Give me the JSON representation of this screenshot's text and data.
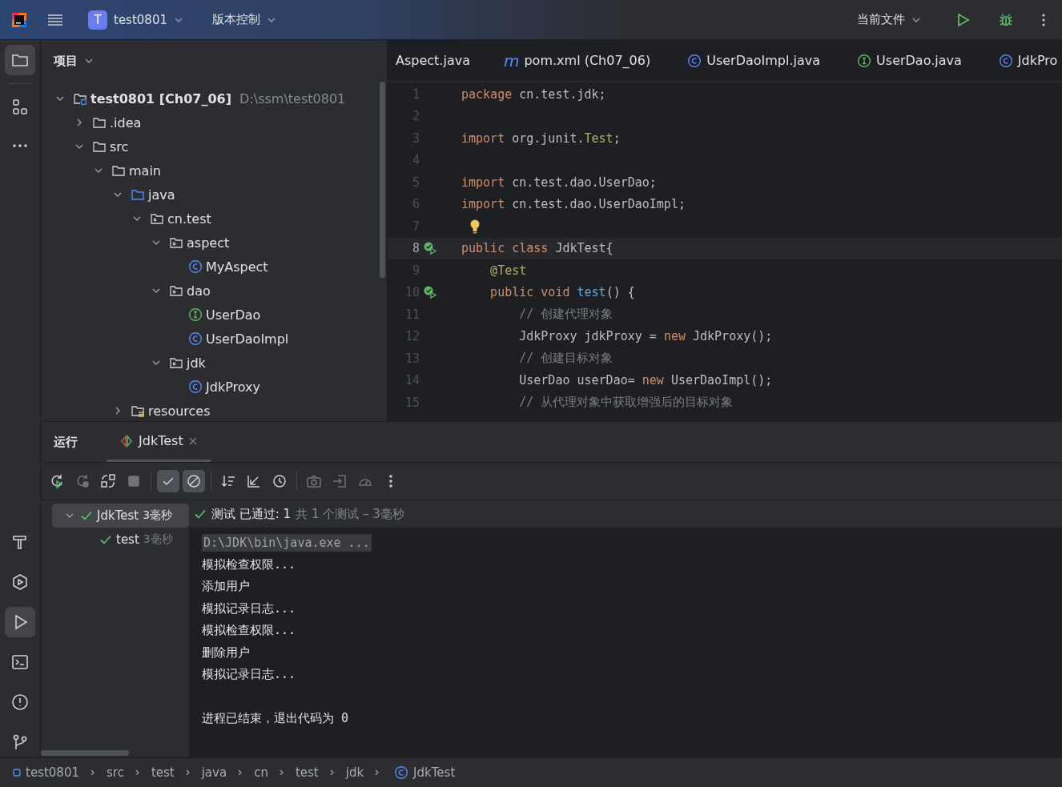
{
  "title_bar": {
    "project_badge": "T",
    "project": "test0801",
    "vcs": "版本控制",
    "run_config": "当前文件"
  },
  "left_rail": {
    "top": [
      {
        "kind": "folder",
        "selected": true
      },
      {
        "kind": "structure",
        "selected": false
      },
      {
        "kind": "more",
        "selected": false
      }
    ],
    "bottom": [
      {
        "kind": "build",
        "selected": false
      },
      {
        "kind": "services",
        "selected": false
      },
      {
        "kind": "run",
        "selected": true
      },
      {
        "kind": "terminal",
        "selected": false
      },
      {
        "kind": "problems",
        "selected": false
      },
      {
        "kind": "git",
        "selected": false
      }
    ]
  },
  "project_panel": {
    "title": "项目",
    "tree": [
      {
        "label": "test0801 [Ch07_06]",
        "detail": "D:\\ssm\\test0801",
        "kind": "module",
        "expanded": true,
        "children": [
          {
            "label": ".idea",
            "kind": "folder",
            "expanded": false
          },
          {
            "label": "src",
            "kind": "folder",
            "expanded": true,
            "children": [
              {
                "label": "main",
                "kind": "folder",
                "expanded": true,
                "children": [
                  {
                    "label": "java",
                    "kind": "source",
                    "expanded": true,
                    "children": [
                      {
                        "label": "cn.test",
                        "kind": "package",
                        "expanded": true,
                        "children": [
                          {
                            "label": "aspect",
                            "kind": "package",
                            "expanded": true,
                            "children": [
                              {
                                "label": "MyAspect",
                                "kind": "class"
                              }
                            ]
                          },
                          {
                            "label": "dao",
                            "kind": "package",
                            "expanded": true,
                            "children": [
                              {
                                "label": "UserDao",
                                "kind": "interface"
                              },
                              {
                                "label": "UserDaoImpl",
                                "kind": "class"
                              }
                            ]
                          },
                          {
                            "label": "jdk",
                            "kind": "package",
                            "expanded": true,
                            "children": [
                              {
                                "label": "JdkProxy",
                                "kind": "class"
                              }
                            ]
                          }
                        ]
                      }
                    ]
                  },
                  {
                    "label": "resources",
                    "kind": "resources",
                    "expanded": false
                  }
                ]
              }
            ]
          }
        ]
      }
    ]
  },
  "editor": {
    "tabs": [
      {
        "label": "Aspect.java",
        "kind": "none",
        "selected": false
      },
      {
        "label": "pom.xml (Ch07_06)",
        "kind": "maven",
        "icon_text": "m",
        "selected": false
      },
      {
        "label": "UserDaoImpl.java",
        "kind": "class",
        "selected": false
      },
      {
        "label": "UserDao.java",
        "kind": "interface",
        "selected": false
      },
      {
        "label": "JdkPro",
        "kind": "class",
        "selected": false
      }
    ],
    "lines": [
      {
        "number": "1",
        "tokens": [
          {
            "kind": "keyword",
            "text": "package "
          },
          {
            "kind": "plain",
            "text": "cn.test.jdk;"
          }
        ]
      },
      {
        "number": "2"
      },
      {
        "number": "3",
        "tokens": [
          {
            "kind": "keyword",
            "text": "import "
          },
          {
            "kind": "plain",
            "text": "org.junit."
          },
          {
            "kind": "annotation",
            "text": "Test"
          },
          {
            "kind": "plain",
            "text": ";"
          }
        ]
      },
      {
        "number": "4"
      },
      {
        "number": "5",
        "tokens": [
          {
            "kind": "keyword",
            "text": "import "
          },
          {
            "kind": "plain",
            "text": "cn.test.dao.UserDao;"
          }
        ]
      },
      {
        "number": "6",
        "tokens": [
          {
            "kind": "keyword",
            "text": "import "
          },
          {
            "kind": "plain",
            "text": "cn.test.dao.UserDaoImpl;"
          }
        ]
      },
      {
        "number": "7",
        "bulb": true
      },
      {
        "number": "8",
        "run_marker": true,
        "current": true,
        "tokens": [
          {
            "kind": "keyword",
            "text": "public class "
          },
          {
            "kind": "plain",
            "text": "JdkTest{"
          }
        ]
      },
      {
        "number": "9",
        "tokens": [
          {
            "kind": "annotation",
            "text": "    @Test"
          }
        ]
      },
      {
        "number": "10",
        "run_marker": true,
        "tokens": [
          {
            "kind": "keyword",
            "text": "    public void "
          },
          {
            "kind": "method",
            "text": "test"
          },
          {
            "kind": "plain",
            "text": "() {"
          }
        ]
      },
      {
        "number": "11",
        "tokens": [
          {
            "kind": "comment",
            "text": "        // 创建代理对象"
          }
        ]
      },
      {
        "number": "12",
        "tokens": [
          {
            "kind": "plain",
            "text": "        JdkProxy jdkProxy = "
          },
          {
            "kind": "keyword",
            "text": "new "
          },
          {
            "kind": "plain",
            "text": "JdkProxy();"
          }
        ]
      },
      {
        "number": "13",
        "tokens": [
          {
            "kind": "comment",
            "text": "        // 创建目标对象"
          }
        ]
      },
      {
        "number": "14",
        "tokens": [
          {
            "kind": "plain",
            "text": "        UserDao userDao= "
          },
          {
            "kind": "keyword",
            "text": "new "
          },
          {
            "kind": "plain",
            "text": "UserDaoImpl();"
          }
        ]
      },
      {
        "number": "15",
        "tokens": [
          {
            "kind": "comment",
            "text": "        // 从代理对象中获取增强后的目标对象"
          }
        ]
      }
    ]
  },
  "run_panel": {
    "title": "运行",
    "tab": "JdkTest",
    "toolbar": [
      {
        "kind": "rerun",
        "disabled": false,
        "selected": false
      },
      {
        "kind": "rerun-failed",
        "disabled": true,
        "selected": false
      },
      {
        "kind": "toggle",
        "disabled": false,
        "selected": false
      },
      {
        "kind": "stop",
        "disabled": true,
        "selected": false
      },
      {
        "kind": "sep"
      },
      {
        "kind": "passed",
        "disabled": false,
        "selected": true
      },
      {
        "kind": "ignored",
        "disabled": false,
        "selected": true
      },
      {
        "kind": "sep"
      },
      {
        "kind": "sort",
        "disabled": false,
        "selected": false
      },
      {
        "kind": "collapse",
        "disabled": false,
        "selected": false
      },
      {
        "kind": "history",
        "disabled": false,
        "selected": false
      },
      {
        "kind": "sep"
      },
      {
        "kind": "camera",
        "disabled": true,
        "selected": false
      },
      {
        "kind": "import",
        "disabled": true,
        "selected": false
      },
      {
        "kind": "gauge",
        "disabled": true,
        "selected": false
      },
      {
        "kind": "more",
        "disabled": false,
        "selected": false
      }
    ],
    "tests": [
      {
        "name": "JdkTest",
        "time": "3毫秒",
        "selected": true,
        "expanded": true,
        "children": [
          {
            "name": "test",
            "time": "3毫秒",
            "selected": false
          }
        ]
      }
    ],
    "summary": {
      "passed": "测试 已通过: 1",
      "total": "共 1 个测试 – 3毫秒"
    },
    "console": [
      {
        "text": "D:\\JDK\\bin\\java.exe ...",
        "kind": "command"
      },
      {
        "text": "模拟检查权限...",
        "kind": "output"
      },
      {
        "text": "添加用户",
        "kind": "output"
      },
      {
        "text": "模拟记录日志...",
        "kind": "output"
      },
      {
        "text": "模拟检查权限...",
        "kind": "output"
      },
      {
        "text": "删除用户",
        "kind": "output"
      },
      {
        "text": "模拟记录日志...",
        "kind": "output"
      },
      {
        "kind": "blank"
      },
      {
        "text": "进程已结束，退出代码为 0",
        "kind": "output"
      }
    ]
  },
  "breadcrumbs": [
    {
      "label": "test0801",
      "kind": "module"
    },
    {
      "label": "src",
      "kind": "folder"
    },
    {
      "label": "test",
      "kind": "folder"
    },
    {
      "label": "java",
      "kind": "folder"
    },
    {
      "label": "cn",
      "kind": "folder"
    },
    {
      "label": "test",
      "kind": "folder"
    },
    {
      "label": "jdk",
      "kind": "folder"
    },
    {
      "label": "JdkTest",
      "kind": "class"
    }
  ]
}
